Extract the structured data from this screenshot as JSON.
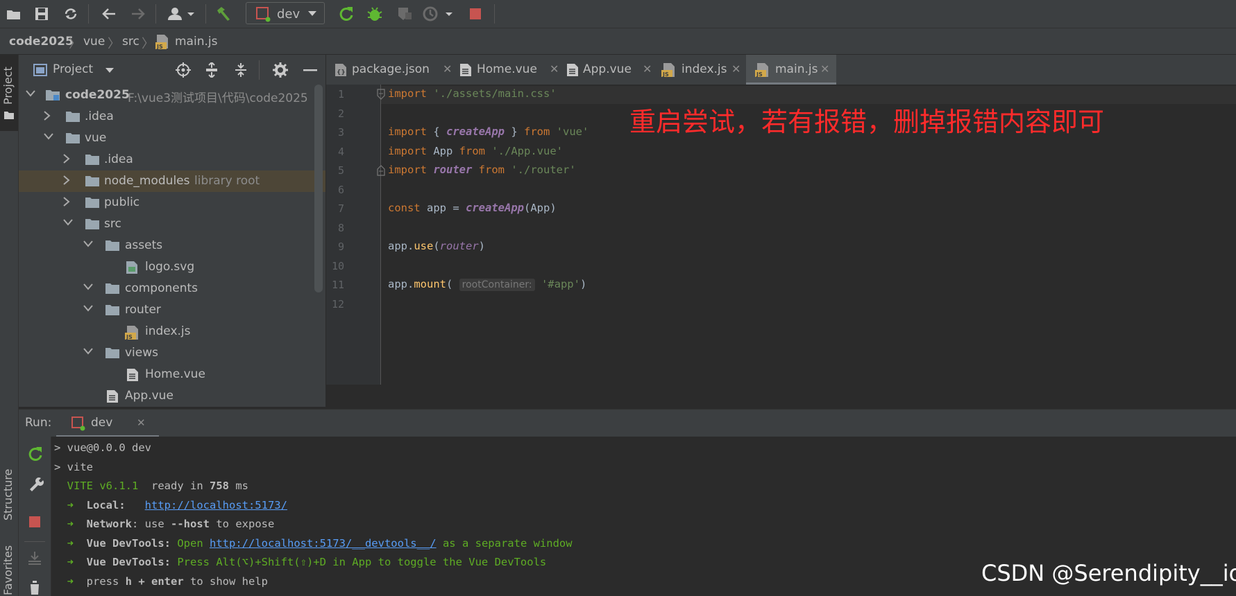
{
  "toolbar": {
    "run_config": "dev"
  },
  "breadcrumb": [
    "code2025",
    "vue",
    "src",
    "main.js"
  ],
  "left_stripe": {
    "project": "Project",
    "structure": "Structure",
    "favorites": "Favorites"
  },
  "project_panel": {
    "title": "Project",
    "tree": [
      {
        "label": "code2025",
        "path": "F:\\vue3测试项目\\代码\\code2025"
      },
      {
        "label": ".idea"
      },
      {
        "label": "vue"
      },
      {
        "label": ".idea"
      },
      {
        "label": "node_modules",
        "hint": "library root"
      },
      {
        "label": "public"
      },
      {
        "label": "src"
      },
      {
        "label": "assets"
      },
      {
        "label": "logo.svg"
      },
      {
        "label": "components"
      },
      {
        "label": "router"
      },
      {
        "label": "index.js"
      },
      {
        "label": "views"
      },
      {
        "label": "Home.vue"
      },
      {
        "label": "App.vue"
      }
    ]
  },
  "tabs": [
    "package.json",
    "Home.vue",
    "App.vue",
    "index.js",
    "main.js"
  ],
  "editor": {
    "line_numbers": [
      "1",
      "2",
      "3",
      "4",
      "5",
      "6",
      "7",
      "8",
      "9",
      "10",
      "11",
      "12"
    ],
    "code": {
      "l1_kw": "import",
      "l1_str": "'./assets/main.css'",
      "l3_kw": "import",
      "l3_a": " { ",
      "l3_fn": "createApp",
      "l3_b": " } ",
      "l3_kw2": "from",
      "l3_str": " 'vue'",
      "l4_kw": "import",
      "l4_a": " App ",
      "l4_kw2": "from",
      "l4_str": " './App.vue'",
      "l5_kw": "import",
      "l5_fn": " router",
      "l5_kw2": " from",
      "l5_str": " './router'",
      "l7_kw": "const",
      "l7_a": " app = ",
      "l7_fn": "createApp",
      "l7_b": "(App)",
      "l9_a": "app.",
      "l9_m": "use",
      "l9_b": "(",
      "l9_fn": "router",
      "l9_c": ")",
      "l11_a": "app.",
      "l11_m": "mount",
      "l11_b": "( ",
      "l11_hint": "rootContainer:",
      "l11_str": " '#app'",
      "l11_c": ")"
    },
    "annotation": "重启尝试，若有报错，删掉报错内容即可"
  },
  "run_panel": {
    "label": "Run:",
    "tab": "dev",
    "console": {
      "l1": "> vue@0.0.0 dev",
      "l2": "> vite",
      "l3_vite": "  VITE v6.1.1",
      "l3_ready": "  ready in ",
      "l3_ms": "758",
      "l3_unit": " ms",
      "l4_arrow": "  ➜  ",
      "l4_label": "Local:",
      "l4_pad": "   ",
      "l4_url": "http://localhost:5173/",
      "l5_arrow": "  ➜  ",
      "l5_label": "Network",
      "l5_a": ": use ",
      "l5_host": "--host",
      "l5_b": " to expose",
      "l6_arrow": "  ➜  ",
      "l6_label": "Vue DevTools:",
      "l6_a": " Open ",
      "l6_url": "http://localhost:5173/__devtools__/",
      "l6_b": " as a separate window",
      "l7_arrow": "  ➜  ",
      "l7_label": "Vue DevTools:",
      "l7_a": " Press Alt(⌥)+Shift(⇧)+D in App to toggle the Vue DevTools",
      "l8_arrow": "  ➜  ",
      "l8_a": "press ",
      "l8_h": "h + enter",
      "l8_b": " to show help"
    }
  },
  "watermark": "CSDN @Serendipity__io",
  "colors": {
    "bg": "#2b2b2b",
    "panel": "#3c3f41",
    "keyword": "#cc7832",
    "string": "#6a8759",
    "annotation": "#ff2b2b",
    "link": "#589df6",
    "vite_green": "#5eac24"
  }
}
